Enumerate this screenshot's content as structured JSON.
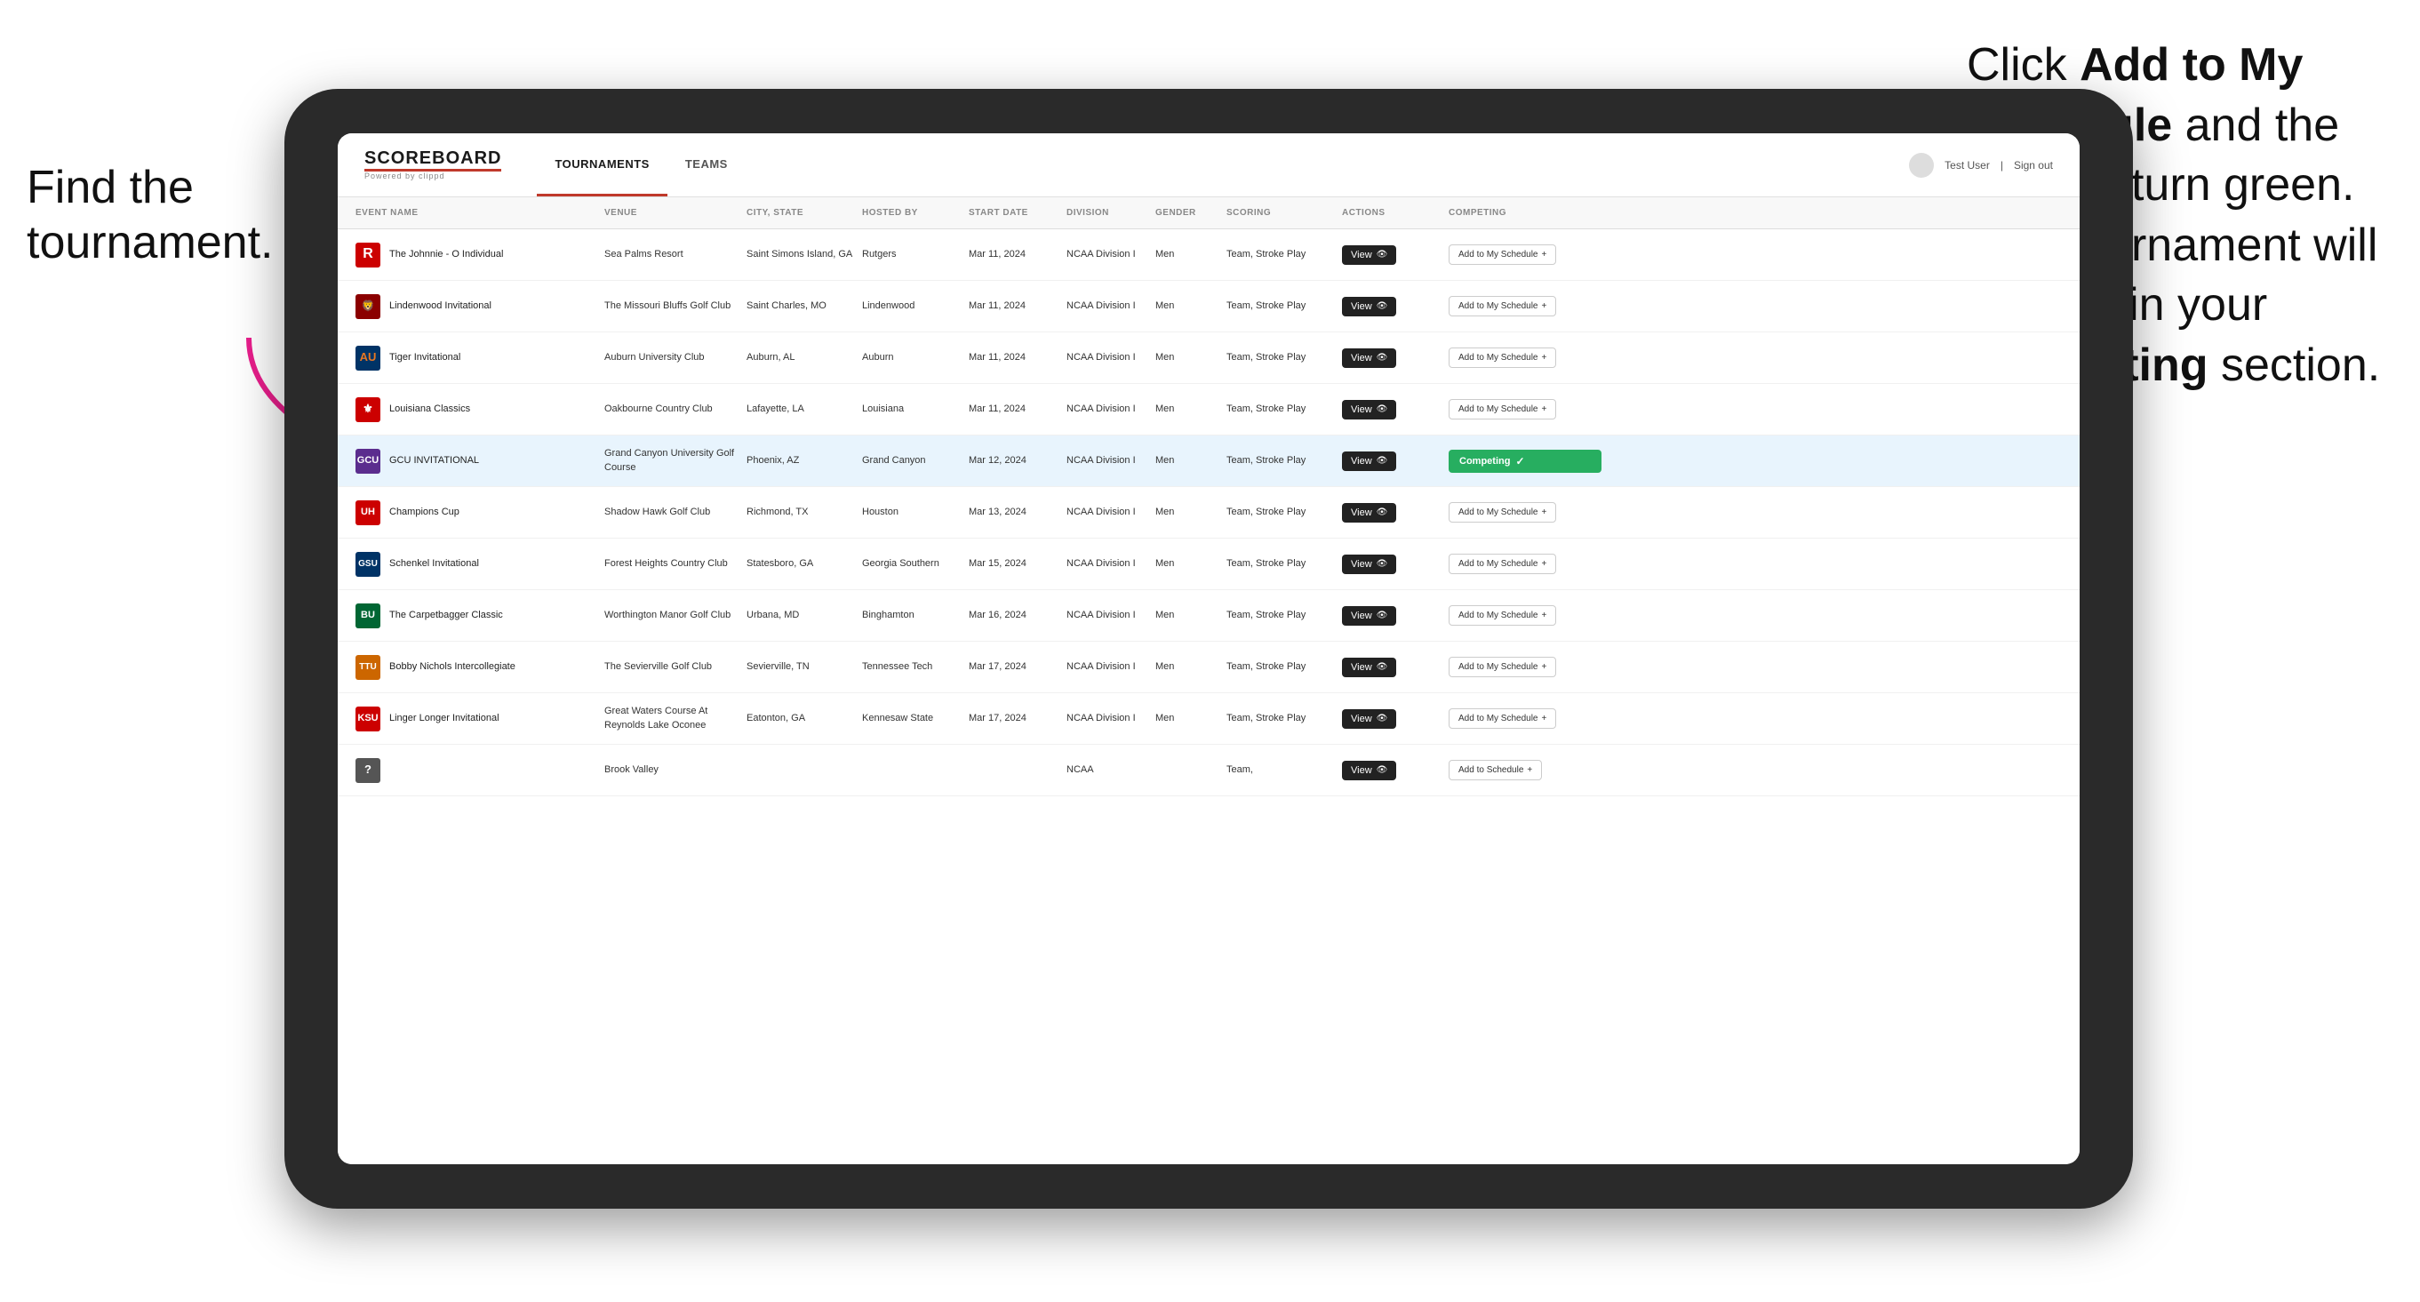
{
  "annotations": {
    "left": "Find the tournament.",
    "right_line1": "Click ",
    "right_bold1": "Add to My Schedule",
    "right_line2": " and the box will turn green. This tournament will now be in your ",
    "right_bold2": "Competing",
    "right_line3": " section."
  },
  "app": {
    "logo": "SCOREBOARD",
    "logo_sub": "Powered by clippd",
    "nav": {
      "tabs": [
        "TOURNAMENTS",
        "TEAMS"
      ],
      "active": "TOURNAMENTS"
    },
    "header_right": {
      "user": "Test User",
      "sign_out": "Sign out"
    }
  },
  "table": {
    "columns": [
      "EVENT NAME",
      "VENUE",
      "CITY, STATE",
      "HOSTED BY",
      "START DATE",
      "DIVISION",
      "GENDER",
      "SCORING",
      "ACTIONS",
      "COMPETING"
    ],
    "rows": [
      {
        "logo_color": "#cc0000",
        "logo_letter": "R",
        "event": "The Johnnie - O Individual",
        "venue": "Sea Palms Resort",
        "city_state": "Saint Simons Island, GA",
        "hosted_by": "Rutgers",
        "start_date": "Mar 11, 2024",
        "division": "NCAA Division I",
        "gender": "Men",
        "scoring": "Team, Stroke Play",
        "action": "View",
        "competing": "Add to My Schedule",
        "is_competing": false,
        "highlighted": false
      },
      {
        "logo_color": "#8B0000",
        "logo_letter": "L",
        "event": "Lindenwood Invitational",
        "venue": "The Missouri Bluffs Golf Club",
        "city_state": "Saint Charles, MO",
        "hosted_by": "Lindenwood",
        "start_date": "Mar 11, 2024",
        "division": "NCAA Division I",
        "gender": "Men",
        "scoring": "Team, Stroke Play",
        "action": "View",
        "competing": "Add to My Schedule",
        "is_competing": false,
        "highlighted": false
      },
      {
        "logo_color": "#003366",
        "logo_letter": "T",
        "event": "Tiger Invitational",
        "venue": "Auburn University Club",
        "city_state": "Auburn, AL",
        "hosted_by": "Auburn",
        "start_date": "Mar 11, 2024",
        "division": "NCAA Division I",
        "gender": "Men",
        "scoring": "Team, Stroke Play",
        "action": "View",
        "competing": "Add to My Schedule",
        "is_competing": false,
        "highlighted": false
      },
      {
        "logo_color": "#cc0000",
        "logo_letter": "L",
        "event": "Louisiana Classics",
        "venue": "Oakbourne Country Club",
        "city_state": "Lafayette, LA",
        "hosted_by": "Louisiana",
        "start_date": "Mar 11, 2024",
        "division": "NCAA Division I",
        "gender": "Men",
        "scoring": "Team, Stroke Play",
        "action": "View",
        "competing": "Add to My Schedule",
        "is_competing": false,
        "highlighted": false
      },
      {
        "logo_color": "#5B2D8E",
        "logo_letter": "G",
        "event": "GCU INVITATIONAL",
        "venue": "Grand Canyon University Golf Course",
        "city_state": "Phoenix, AZ",
        "hosted_by": "Grand Canyon",
        "start_date": "Mar 12, 2024",
        "division": "NCAA Division I",
        "gender": "Men",
        "scoring": "Team, Stroke Play",
        "action": "View",
        "competing": "Competing",
        "is_competing": true,
        "highlighted": true
      },
      {
        "logo_color": "#cc0000",
        "logo_letter": "C",
        "event": "Champions Cup",
        "venue": "Shadow Hawk Golf Club",
        "city_state": "Richmond, TX",
        "hosted_by": "Houston",
        "start_date": "Mar 13, 2024",
        "division": "NCAA Division I",
        "gender": "Men",
        "scoring": "Team, Stroke Play",
        "action": "View",
        "competing": "Add to My Schedule",
        "is_competing": false,
        "highlighted": false
      },
      {
        "logo_color": "#003366",
        "logo_letter": "S",
        "event": "Schenkel Invitational",
        "venue": "Forest Heights Country Club",
        "city_state": "Statesboro, GA",
        "hosted_by": "Georgia Southern",
        "start_date": "Mar 15, 2024",
        "division": "NCAA Division I",
        "gender": "Men",
        "scoring": "Team, Stroke Play",
        "action": "View",
        "competing": "Add to My Schedule",
        "is_competing": false,
        "highlighted": false
      },
      {
        "logo_color": "#006633",
        "logo_letter": "B",
        "event": "The Carpetbagger Classic",
        "venue": "Worthington Manor Golf Club",
        "city_state": "Urbana, MD",
        "hosted_by": "Binghamton",
        "start_date": "Mar 16, 2024",
        "division": "NCAA Division I",
        "gender": "Men",
        "scoring": "Team, Stroke Play",
        "action": "View",
        "competing": "Add to My Schedule",
        "is_competing": false,
        "highlighted": false
      },
      {
        "logo_color": "#cc6600",
        "logo_letter": "B",
        "event": "Bobby Nichols Intercollegiate",
        "venue": "The Sevierville Golf Club",
        "city_state": "Sevierville, TN",
        "hosted_by": "Tennessee Tech",
        "start_date": "Mar 17, 2024",
        "division": "NCAA Division I",
        "gender": "Men",
        "scoring": "Team, Stroke Play",
        "action": "View",
        "competing": "Add to My Schedule",
        "is_competing": false,
        "highlighted": false
      },
      {
        "logo_color": "#cc0000",
        "logo_letter": "L",
        "event": "Linger Longer Invitational",
        "venue": "Great Waters Course At Reynolds Lake Oconee",
        "city_state": "Eatonton, GA",
        "hosted_by": "Kennesaw State",
        "start_date": "Mar 17, 2024",
        "division": "NCAA Division I",
        "gender": "Men",
        "scoring": "Team, Stroke Play",
        "action": "View",
        "competing": "Add to My Schedule",
        "is_competing": false,
        "highlighted": false
      },
      {
        "logo_color": "#555",
        "logo_letter": "?",
        "event": "",
        "venue": "Brook Valley",
        "city_state": "",
        "hosted_by": "",
        "start_date": "",
        "division": "NCAA",
        "gender": "",
        "scoring": "Team,",
        "action": "View",
        "competing": "Add to Schedule",
        "is_competing": false,
        "highlighted": false,
        "partial": true
      }
    ]
  }
}
